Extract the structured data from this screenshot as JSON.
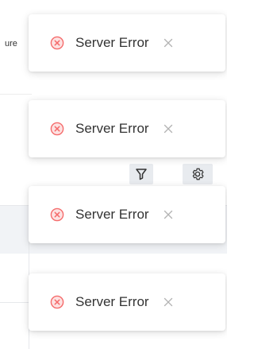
{
  "background": {
    "truncated_label": "ure",
    "toolbar_icons": [
      "filter-icon",
      "gear-icon"
    ]
  },
  "toasts": [
    {
      "message": "Server Error",
      "icon": "error-circle-icon",
      "close_icon": "close-icon"
    },
    {
      "message": "Server Error",
      "icon": "error-circle-icon",
      "close_icon": "close-icon"
    },
    {
      "message": "Server Error",
      "icon": "error-circle-icon",
      "close_icon": "close-icon"
    },
    {
      "message": "Server Error",
      "icon": "error-circle-icon",
      "close_icon": "close-icon"
    }
  ],
  "colors": {
    "error": "#f56c6c",
    "text": "#333333",
    "close": "#b3b3b3"
  }
}
